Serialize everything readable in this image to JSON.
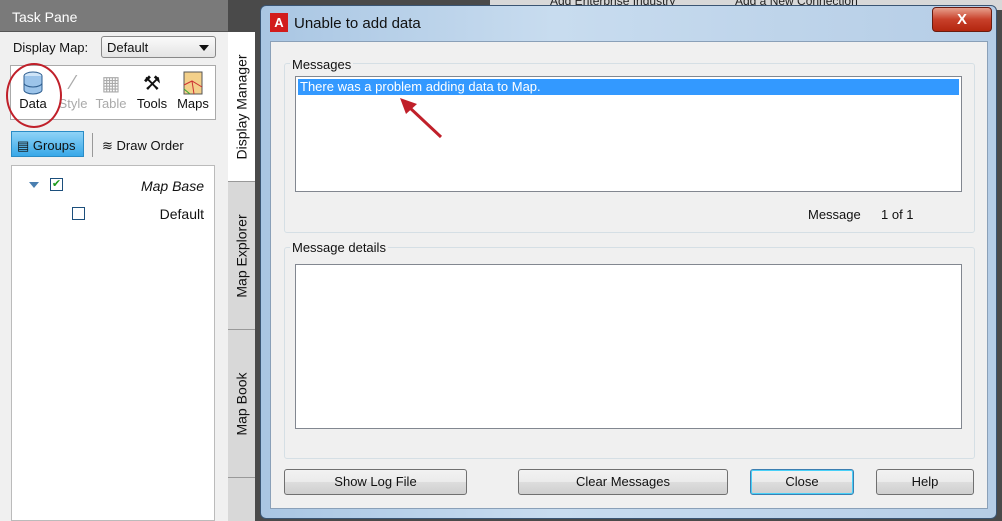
{
  "background": {
    "items": [
      "Add Enterprise Industry",
      "Add a New Connection"
    ]
  },
  "task_pane": {
    "title": "Task Pane",
    "display_map_label": "Display Map:",
    "display_map_value": "Default",
    "ribbon": [
      {
        "label": "Data",
        "icon": "database-icon",
        "enabled": true
      },
      {
        "label": "Style",
        "icon": "brush-icon",
        "enabled": false
      },
      {
        "label": "Table",
        "icon": "table-icon",
        "enabled": false
      },
      {
        "label": "Tools",
        "icon": "tools-icon",
        "enabled": true
      },
      {
        "label": "Maps",
        "icon": "map-icon",
        "enabled": true
      }
    ],
    "groups_label": "Groups",
    "draw_order_label": "Draw Order",
    "tree": [
      {
        "label": "Map Base",
        "checked": true,
        "expanded": true
      },
      {
        "label": "Default",
        "checked": false
      }
    ],
    "vertical_tabs": [
      "Display Manager",
      "Map Explorer",
      "Map Book"
    ]
  },
  "dialog": {
    "title": "Unable to add data",
    "close_glyph": "X",
    "messages_label": "Messages",
    "messages": [
      "There was a problem adding data to Map."
    ],
    "message_counter_label": "Message",
    "message_counter": "1 of 1",
    "details_label": "Message details",
    "buttons": {
      "show_log": "Show Log File",
      "clear": "Clear Messages",
      "close": "Close",
      "help": "Help"
    }
  },
  "colors": {
    "selection": "#3399ff",
    "annotation": "#c0202a",
    "accent": "#38a8e8"
  }
}
